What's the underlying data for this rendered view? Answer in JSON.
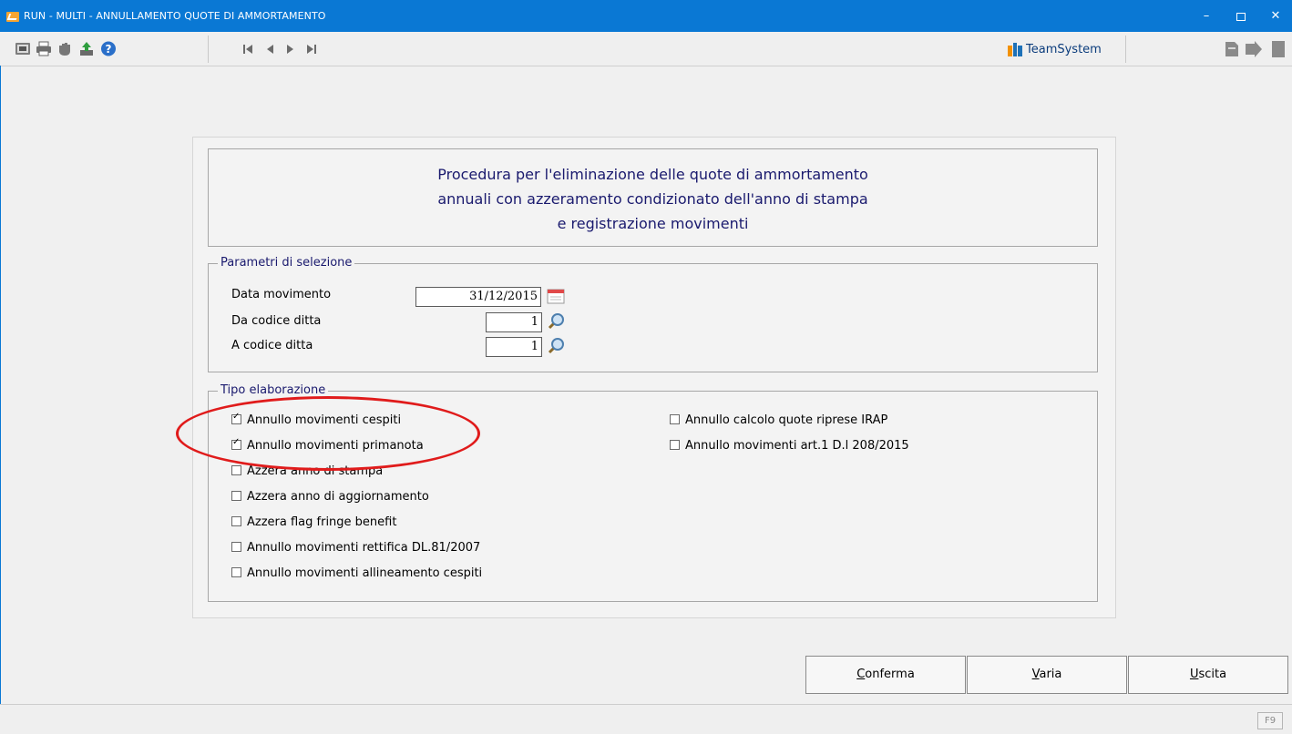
{
  "window": {
    "title": "RUN - MULTI - ANNULLAMENTO QUOTE DI AMMORTAMENTO",
    "minimize_glyph": "–",
    "close_glyph": "✕"
  },
  "toolbar": {
    "icons": [
      "calculator-icon",
      "printer-icon",
      "hand-icon",
      "export-icon",
      "help-icon"
    ],
    "nav_icons": [
      "first-record-icon",
      "previous-record-icon",
      "next-record-icon",
      "last-record-icon"
    ],
    "logo_text": "TeamSystem",
    "right_icons": [
      "document-icon",
      "forward-arrow-icon",
      "page-icon"
    ]
  },
  "header": {
    "line1": "Procedura per l'eliminazione delle quote di ammortamento",
    "line2": "annuali con azzeramento condizionato dell'anno di stampa",
    "line3": "e registrazione movimenti"
  },
  "selection": {
    "legend": "Parametri di selezione",
    "data_movimento_label": "Data movimento",
    "data_movimento_value": "31/12/2015",
    "da_codice_label": "Da codice ditta",
    "da_codice_value": "1",
    "a_codice_label": "A  codice ditta",
    "a_codice_value": "1"
  },
  "tipo": {
    "legend": "Tipo elaborazione",
    "left": [
      {
        "label": "Annullo movimenti cespiti",
        "checked": true
      },
      {
        "label": "Annullo movimenti primanota",
        "checked": true
      },
      {
        "label": "Azzera anno di stampa",
        "checked": false
      },
      {
        "label": "Azzera anno di aggiornamento",
        "checked": false
      },
      {
        "label": "Azzera flag fringe benefit",
        "checked": false
      },
      {
        "label": "Annullo movimenti rettifica DL.81/2007",
        "checked": false
      },
      {
        "label": "Annullo movimenti allineamento cespiti",
        "checked": false
      }
    ],
    "right": [
      {
        "label": "Annullo calcolo quote riprese IRAP",
        "checked": false
      },
      {
        "label": "Annullo movimenti art.1 D.l 208/2015",
        "checked": false
      }
    ]
  },
  "buttons": {
    "confirm_label": "Conferma",
    "edit_label": "Varia",
    "exit_label": "Uscita"
  },
  "status": {
    "f9_label": "F9"
  },
  "colors": {
    "titlebar": "#0a78d4",
    "legend_text": "#1a1a6e",
    "annotation": "#e01b1b"
  }
}
